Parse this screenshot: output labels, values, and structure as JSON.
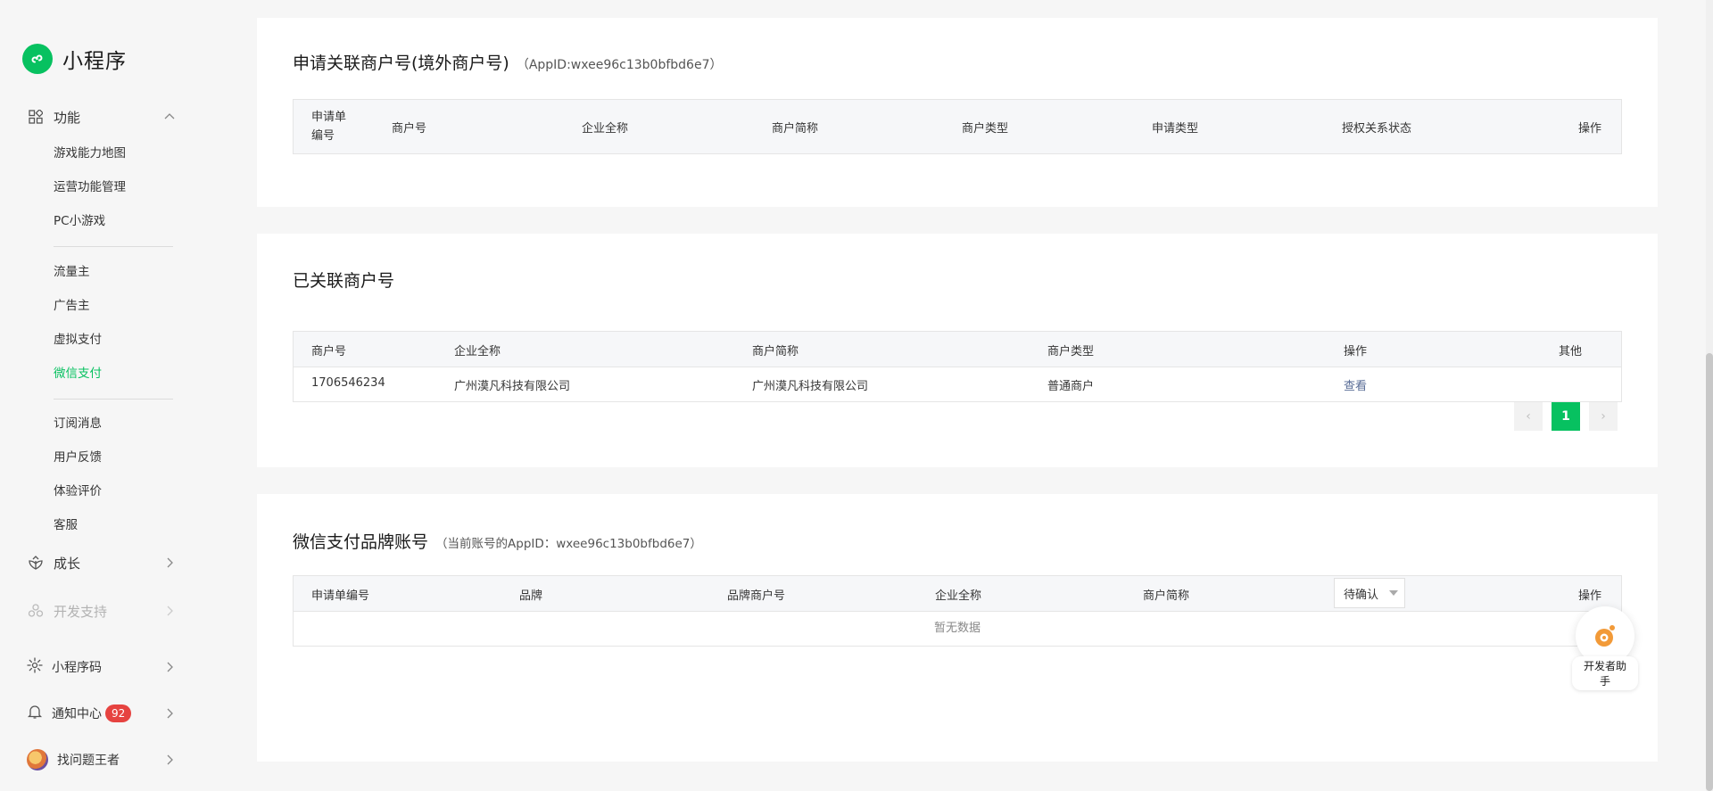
{
  "brand": {
    "title": "小程序"
  },
  "sidebar": {
    "feature_group": "功能",
    "feature_items": [
      "游戏能力地图",
      "运营功能管理",
      "PC小游戏"
    ],
    "traffic_items": [
      "流量主",
      "广告主",
      "虚拟支付",
      "微信支付"
    ],
    "service_items": [
      "订阅消息",
      "用户反馈",
      "体验评价",
      "客服"
    ],
    "growth_group": "成长",
    "dev_support_group": "开发支持",
    "qrcode": "小程序码",
    "notify": "通知中心",
    "notify_count": "92",
    "user": "找问题王者"
  },
  "card1": {
    "title": "申请关联商户号(境外商户号)",
    "appid": "（AppID:wxee96c13b0bfbd6e7）",
    "headers": [
      "申请单编号",
      "商户号",
      "企业全称",
      "商户简称",
      "商户类型",
      "申请类型",
      "授权关系状态",
      "操作"
    ]
  },
  "card2": {
    "title": "已关联商户号",
    "headers": [
      "商户号",
      "企业全称",
      "商户简称",
      "商户类型",
      "操作",
      "其他"
    ],
    "row": {
      "merchant_id": "1706546234",
      "company": "广州漠凡科技有限公司",
      "short_name": "广州漠凡科技有限公司",
      "type": "普通商户",
      "action": "查看"
    },
    "pager": {
      "prev": "‹",
      "current": "1",
      "next": "›"
    }
  },
  "card3": {
    "title": "微信支付品牌账号",
    "appid": "（当前账号的AppID：wxee96c13b0bfbd6e7）",
    "headers": [
      "申请单编号",
      "品牌",
      "品牌商户号",
      "企业全称",
      "商户简称",
      "操作"
    ],
    "status_select": "待确认",
    "empty": "暂无数据"
  },
  "helper": {
    "label": "开发者助手"
  },
  "colors": {
    "accent": "#07c160",
    "link": "#576b95",
    "badge": "#e64340"
  }
}
